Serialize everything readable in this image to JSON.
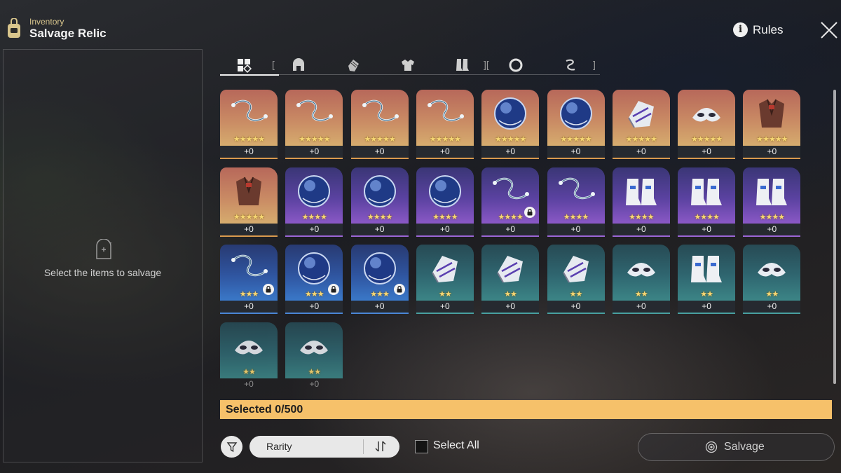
{
  "header": {
    "subtitle": "Inventory",
    "title": "Salvage Relic",
    "bag_icon": "backpack-icon"
  },
  "rules": {
    "label": "Rules"
  },
  "left_panel": {
    "empty_text": "Select the items to salvage"
  },
  "tabs": [
    {
      "name": "all",
      "icon": "grid-icon",
      "active": true
    },
    {
      "name": "head",
      "icon": "helmet-icon",
      "active": false
    },
    {
      "name": "hands",
      "icon": "glove-icon",
      "active": false
    },
    {
      "name": "body",
      "icon": "armor-icon",
      "active": false
    },
    {
      "name": "feet",
      "icon": "boots-icon",
      "active": false
    },
    {
      "name": "sphere",
      "icon": "ring-icon",
      "active": false
    },
    {
      "name": "rope",
      "icon": "rope-icon",
      "active": false
    }
  ],
  "items": [
    {
      "type": "rope",
      "rarity": 5,
      "level": "+0",
      "locked": false
    },
    {
      "type": "rope",
      "rarity": 5,
      "level": "+0",
      "locked": false
    },
    {
      "type": "rope",
      "rarity": 5,
      "level": "+0",
      "locked": false
    },
    {
      "type": "rope",
      "rarity": 5,
      "level": "+0",
      "locked": false
    },
    {
      "type": "sphere",
      "rarity": 5,
      "level": "+0",
      "locked": false
    },
    {
      "type": "sphere",
      "rarity": 5,
      "level": "+0",
      "locked": false
    },
    {
      "type": "hands",
      "rarity": 5,
      "level": "+0",
      "locked": false
    },
    {
      "type": "head",
      "rarity": 5,
      "level": "+0",
      "locked": false
    },
    {
      "type": "body",
      "rarity": 5,
      "level": "+0",
      "locked": false
    },
    {
      "type": "body",
      "rarity": 5,
      "level": "+0",
      "locked": false
    },
    {
      "type": "sphere",
      "rarity": 4,
      "level": "+0",
      "locked": false
    },
    {
      "type": "sphere",
      "rarity": 4,
      "level": "+0",
      "locked": false
    },
    {
      "type": "sphere",
      "rarity": 4,
      "level": "+0",
      "locked": false
    },
    {
      "type": "rope",
      "rarity": 4,
      "level": "+0",
      "locked": true
    },
    {
      "type": "rope",
      "rarity": 4,
      "level": "+0",
      "locked": false
    },
    {
      "type": "feet",
      "rarity": 4,
      "level": "+0",
      "locked": false
    },
    {
      "type": "feet",
      "rarity": 4,
      "level": "+0",
      "locked": false
    },
    {
      "type": "feet",
      "rarity": 4,
      "level": "+0",
      "locked": false
    },
    {
      "type": "rope",
      "rarity": 3,
      "level": "+0",
      "locked": true
    },
    {
      "type": "sphere",
      "rarity": 3,
      "level": "+0",
      "locked": true
    },
    {
      "type": "sphere",
      "rarity": 3,
      "level": "+0",
      "locked": true
    },
    {
      "type": "hands",
      "rarity": 2,
      "level": "+0",
      "locked": false
    },
    {
      "type": "hands",
      "rarity": 2,
      "level": "+0",
      "locked": false
    },
    {
      "type": "hands",
      "rarity": 2,
      "level": "+0",
      "locked": false
    },
    {
      "type": "head",
      "rarity": 2,
      "level": "+0",
      "locked": false
    },
    {
      "type": "feet",
      "rarity": 2,
      "level": "+0",
      "locked": false
    },
    {
      "type": "head",
      "rarity": 2,
      "level": "+0",
      "locked": false
    },
    {
      "type": "head",
      "rarity": 2,
      "level": "+0",
      "locked": false
    },
    {
      "type": "head",
      "rarity": 2,
      "level": "+0",
      "locked": false
    }
  ],
  "selection": {
    "label": "Selected 0/500"
  },
  "controls": {
    "filter_icon": "filter-icon",
    "sort_label": "Rarity",
    "sort_icon": "sort-order-icon",
    "select_all_label": "Select All",
    "select_all_checked": false,
    "salvage_label": "Salvage",
    "salvage_icon": "salvage-icon"
  },
  "colors": {
    "rarity5": "#c98a64",
    "rarity4": "#5a42a0",
    "rarity3": "#2f55a0",
    "rarity2": "#2f6670",
    "selection_bar": "#f6c16a",
    "star": "#f7d774"
  }
}
